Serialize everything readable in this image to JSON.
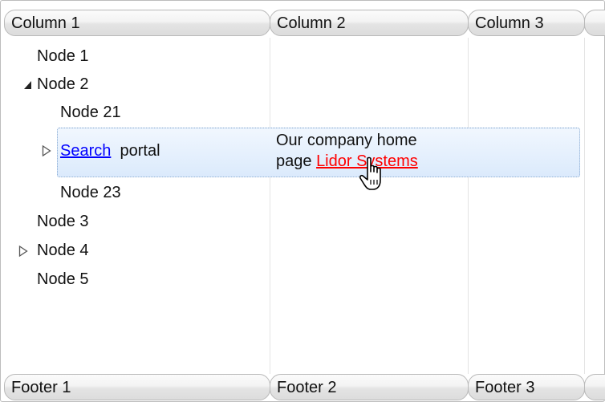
{
  "header": {
    "col1": "Column 1",
    "col2": "Column 2",
    "col3": "Column 3"
  },
  "footer": {
    "col1": "Footer 1",
    "col2": "Footer 2",
    "col3": "Footer 3"
  },
  "tree": {
    "node1": "Node 1",
    "node2": "Node 2",
    "node21": "Node 21",
    "search_link": "Search",
    "portal": "portal",
    "node23": "Node 23",
    "node3": "Node 3",
    "node4": "Node 4",
    "node5": "Node 5"
  },
  "details": {
    "line1": "Our company home",
    "page_word": "page",
    "link": "Lidor Systems"
  },
  "colors": {
    "link_blue": "#0000ff",
    "link_red": "#ff0000",
    "selection": "#dbeafc"
  },
  "icons": {
    "expanded": "triangle-expanded-icon",
    "collapsed": "triangle-collapsed-icon",
    "cursor": "hand-pointer-icon"
  }
}
